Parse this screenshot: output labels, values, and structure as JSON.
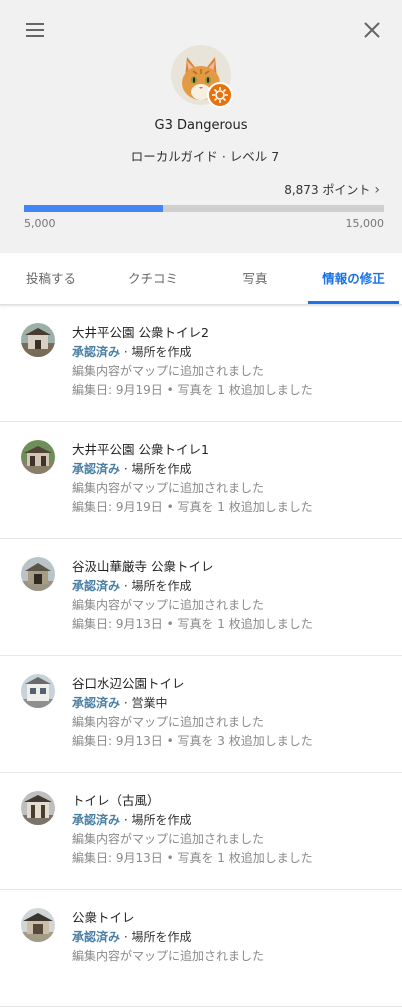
{
  "header": {
    "user_name": "G3 Dangerous",
    "level_text": "ローカルガイド · レベル 7",
    "points_text": "8,873 ポイント",
    "progress_fraction": 0.3873,
    "progress_min": "5,000",
    "progress_max": "15,000",
    "colors": {
      "accent": "#4285f4",
      "badge": "#e8710a"
    }
  },
  "tabs": [
    {
      "label": "投稿する"
    },
    {
      "label": "クチコミ"
    },
    {
      "label": "写真"
    },
    {
      "label": "情報の修正",
      "active": true
    }
  ],
  "edits": [
    {
      "title": "大井平公園 公衆トイレ2",
      "status": "承認済み",
      "action": "場所を作成",
      "note": "編集内容がマップに追加されました",
      "meta": "編集日: 9月19日 • 写真を 1 枚追加しました"
    },
    {
      "title": "大井平公園 公衆トイレ1",
      "status": "承認済み",
      "action": "場所を作成",
      "note": "編集内容がマップに追加されました",
      "meta": "編集日: 9月19日 • 写真を 1 枚追加しました"
    },
    {
      "title": "谷汲山華厳寺 公衆トイレ",
      "status": "承認済み",
      "action": "場所を作成",
      "note": "編集内容がマップに追加されました",
      "meta": "編集日: 9月13日 • 写真を 1 枚追加しました"
    },
    {
      "title": "谷口水辺公園トイレ",
      "status": "承認済み",
      "action": "営業中",
      "note": "編集内容がマップに追加されました",
      "meta": "編集日: 9月13日 • 写真を 3 枚追加しました"
    },
    {
      "title": "トイレ（古風）",
      "status": "承認済み",
      "action": "場所を作成",
      "note": "編集内容がマップに追加されました",
      "meta": "編集日: 9月13日 • 写真を 1 枚追加しました"
    },
    {
      "title": "公衆トイレ",
      "status": "承認済み",
      "action": "場所を作成",
      "note": "編集内容がマップに追加されました",
      "meta": ""
    }
  ]
}
